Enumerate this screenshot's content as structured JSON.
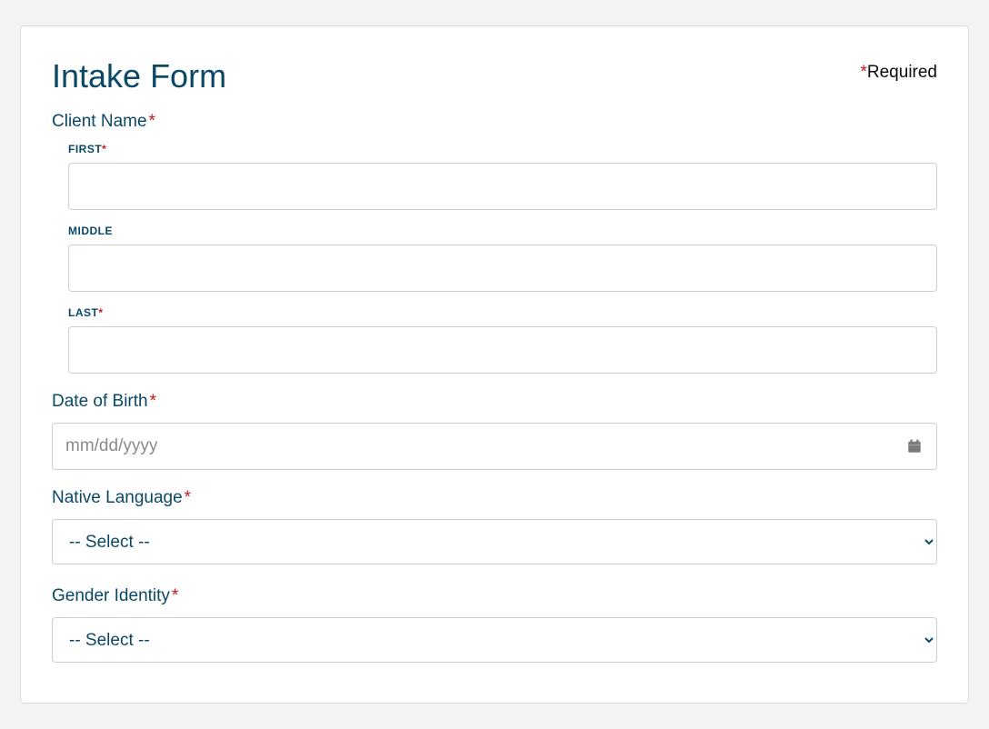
{
  "header": {
    "title": "Intake Form",
    "required_label": "Required"
  },
  "client_name": {
    "label": "Client Name",
    "first_label": "FIRST",
    "middle_label": "MIDDLE",
    "last_label": "LAST",
    "first_value": "",
    "middle_value": "",
    "last_value": ""
  },
  "dob": {
    "label": "Date of Birth",
    "placeholder": "mm/dd/yyyy",
    "value": ""
  },
  "native_language": {
    "label": "Native Language",
    "selected": "-- Select --"
  },
  "gender_identity": {
    "label": "Gender Identity",
    "selected": "-- Select --"
  }
}
